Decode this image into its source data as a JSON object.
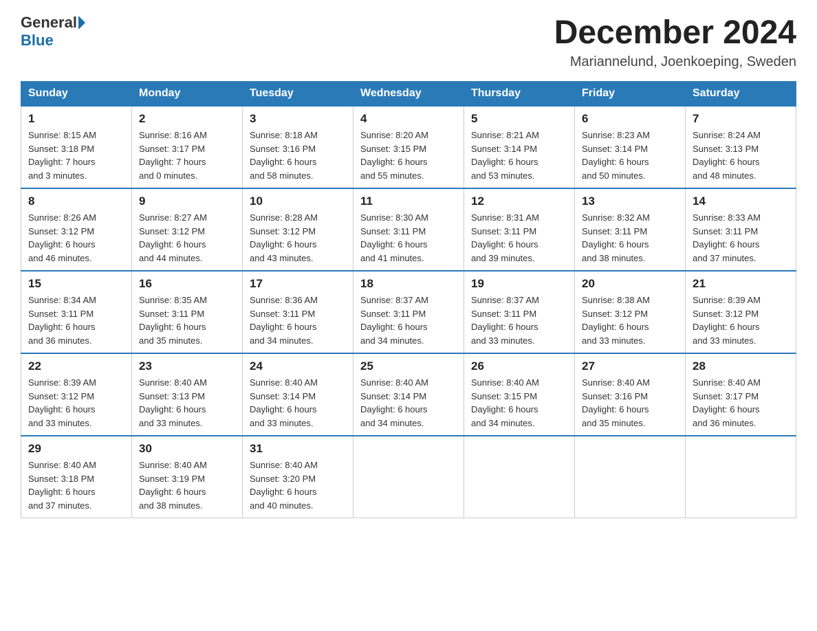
{
  "logo": {
    "general": "General",
    "blue": "Blue"
  },
  "header": {
    "month": "December 2024",
    "location": "Mariannelund, Joenkoeping, Sweden"
  },
  "weekdays": [
    "Sunday",
    "Monday",
    "Tuesday",
    "Wednesday",
    "Thursday",
    "Friday",
    "Saturday"
  ],
  "weeks": [
    [
      {
        "day": "1",
        "sunrise": "8:15 AM",
        "sunset": "3:18 PM",
        "daylight": "7 hours and 3 minutes."
      },
      {
        "day": "2",
        "sunrise": "8:16 AM",
        "sunset": "3:17 PM",
        "daylight": "7 hours and 0 minutes."
      },
      {
        "day": "3",
        "sunrise": "8:18 AM",
        "sunset": "3:16 PM",
        "daylight": "6 hours and 58 minutes."
      },
      {
        "day": "4",
        "sunrise": "8:20 AM",
        "sunset": "3:15 PM",
        "daylight": "6 hours and 55 minutes."
      },
      {
        "day": "5",
        "sunrise": "8:21 AM",
        "sunset": "3:14 PM",
        "daylight": "6 hours and 53 minutes."
      },
      {
        "day": "6",
        "sunrise": "8:23 AM",
        "sunset": "3:14 PM",
        "daylight": "6 hours and 50 minutes."
      },
      {
        "day": "7",
        "sunrise": "8:24 AM",
        "sunset": "3:13 PM",
        "daylight": "6 hours and 48 minutes."
      }
    ],
    [
      {
        "day": "8",
        "sunrise": "8:26 AM",
        "sunset": "3:12 PM",
        "daylight": "6 hours and 46 minutes."
      },
      {
        "day": "9",
        "sunrise": "8:27 AM",
        "sunset": "3:12 PM",
        "daylight": "6 hours and 44 minutes."
      },
      {
        "day": "10",
        "sunrise": "8:28 AM",
        "sunset": "3:12 PM",
        "daylight": "6 hours and 43 minutes."
      },
      {
        "day": "11",
        "sunrise": "8:30 AM",
        "sunset": "3:11 PM",
        "daylight": "6 hours and 41 minutes."
      },
      {
        "day": "12",
        "sunrise": "8:31 AM",
        "sunset": "3:11 PM",
        "daylight": "6 hours and 39 minutes."
      },
      {
        "day": "13",
        "sunrise": "8:32 AM",
        "sunset": "3:11 PM",
        "daylight": "6 hours and 38 minutes."
      },
      {
        "day": "14",
        "sunrise": "8:33 AM",
        "sunset": "3:11 PM",
        "daylight": "6 hours and 37 minutes."
      }
    ],
    [
      {
        "day": "15",
        "sunrise": "8:34 AM",
        "sunset": "3:11 PM",
        "daylight": "6 hours and 36 minutes."
      },
      {
        "day": "16",
        "sunrise": "8:35 AM",
        "sunset": "3:11 PM",
        "daylight": "6 hours and 35 minutes."
      },
      {
        "day": "17",
        "sunrise": "8:36 AM",
        "sunset": "3:11 PM",
        "daylight": "6 hours and 34 minutes."
      },
      {
        "day": "18",
        "sunrise": "8:37 AM",
        "sunset": "3:11 PM",
        "daylight": "6 hours and 34 minutes."
      },
      {
        "day": "19",
        "sunrise": "8:37 AM",
        "sunset": "3:11 PM",
        "daylight": "6 hours and 33 minutes."
      },
      {
        "day": "20",
        "sunrise": "8:38 AM",
        "sunset": "3:12 PM",
        "daylight": "6 hours and 33 minutes."
      },
      {
        "day": "21",
        "sunrise": "8:39 AM",
        "sunset": "3:12 PM",
        "daylight": "6 hours and 33 minutes."
      }
    ],
    [
      {
        "day": "22",
        "sunrise": "8:39 AM",
        "sunset": "3:12 PM",
        "daylight": "6 hours and 33 minutes."
      },
      {
        "day": "23",
        "sunrise": "8:40 AM",
        "sunset": "3:13 PM",
        "daylight": "6 hours and 33 minutes."
      },
      {
        "day": "24",
        "sunrise": "8:40 AM",
        "sunset": "3:14 PM",
        "daylight": "6 hours and 33 minutes."
      },
      {
        "day": "25",
        "sunrise": "8:40 AM",
        "sunset": "3:14 PM",
        "daylight": "6 hours and 34 minutes."
      },
      {
        "day": "26",
        "sunrise": "8:40 AM",
        "sunset": "3:15 PM",
        "daylight": "6 hours and 34 minutes."
      },
      {
        "day": "27",
        "sunrise": "8:40 AM",
        "sunset": "3:16 PM",
        "daylight": "6 hours and 35 minutes."
      },
      {
        "day": "28",
        "sunrise": "8:40 AM",
        "sunset": "3:17 PM",
        "daylight": "6 hours and 36 minutes."
      }
    ],
    [
      {
        "day": "29",
        "sunrise": "8:40 AM",
        "sunset": "3:18 PM",
        "daylight": "6 hours and 37 minutes."
      },
      {
        "day": "30",
        "sunrise": "8:40 AM",
        "sunset": "3:19 PM",
        "daylight": "6 hours and 38 minutes."
      },
      {
        "day": "31",
        "sunrise": "8:40 AM",
        "sunset": "3:20 PM",
        "daylight": "6 hours and 40 minutes."
      },
      null,
      null,
      null,
      null
    ]
  ],
  "labels": {
    "sunrise": "Sunrise:",
    "sunset": "Sunset:",
    "daylight": "Daylight:"
  }
}
